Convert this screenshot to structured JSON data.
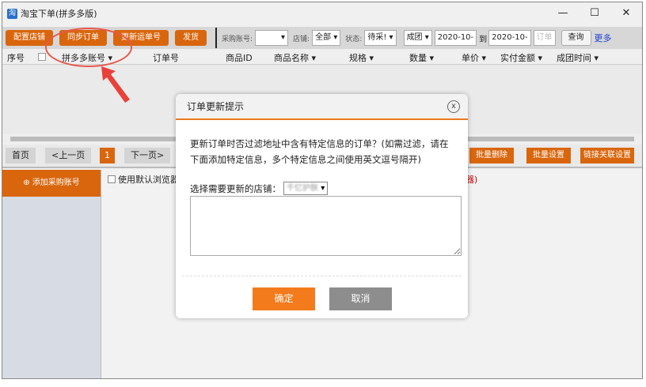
{
  "window": {
    "title": "淘宝下单(拼多多版)",
    "minimize": "—",
    "maximize": "☐",
    "close": "✕"
  },
  "toolbar": {
    "buttons": [
      "配置店铺",
      "同步订单",
      "更新运单号",
      "发货"
    ],
    "purchase_label": "采购账号:",
    "purchase_value": "",
    "shop_label": "店铺:",
    "shop_value": "全部",
    "status_label": "状态:",
    "status_value": "待采!",
    "group_value": "成团",
    "date_from": "2020-10-",
    "to_label": "到",
    "date_to": "2020-10-",
    "order_placeholder": "订单",
    "query": "查询",
    "more": "更多"
  },
  "columns": [
    "序号",
    "拼多多账号 ▾",
    "订单号",
    "商品ID",
    "商品名称 ▾",
    "规格 ▾",
    "数量 ▾",
    "单价 ▾",
    "实付金额 ▾",
    "成团时间 ▾"
  ],
  "pager": {
    "first": "首页",
    "prev": "<上一页",
    "current": "1",
    "next": "下一页>",
    "batch_delete": "批量删除",
    "batch_set": "批量设置",
    "link_set": "链接关联设置"
  },
  "side": {
    "add_account": "添加采购账号"
  },
  "bottom": {
    "default_browser": "使用默认浏览器",
    "red_fragment": "器)"
  },
  "dialog": {
    "title": "订单更新提示",
    "close": "x",
    "message": "更新订单时否过滤地址中含有特定信息的订单？(如需过滤，请在下面添加特定信息，多个特定信息之间使用英文逗号隔开)",
    "shop_label": "选择需要更新的店铺：",
    "shop_value": "千忆护肤",
    "textarea": "",
    "ok": "确定",
    "cancel": "取消"
  }
}
